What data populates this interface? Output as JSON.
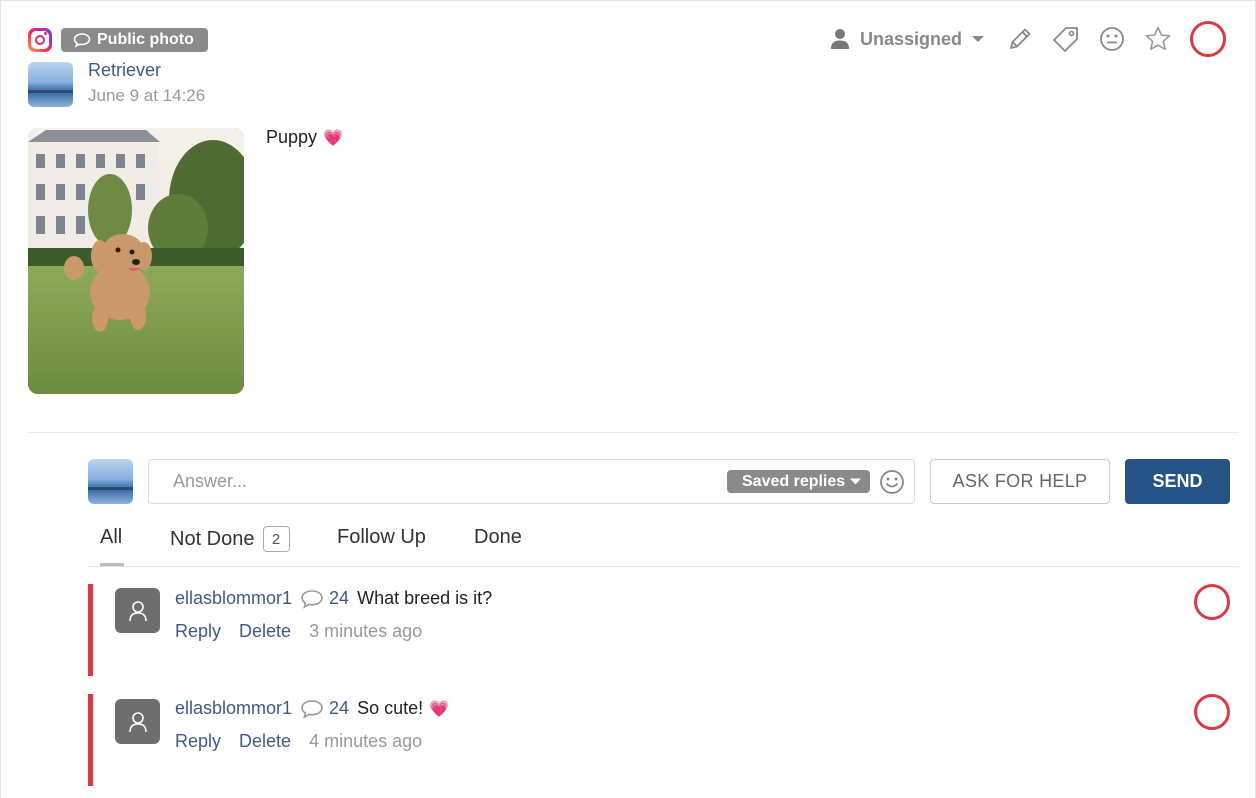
{
  "post": {
    "badge_label": "Public photo",
    "author_name": "Retriever",
    "date": "June 9 at 14:26",
    "caption": "Puppy",
    "caption_emoji": "💗"
  },
  "toolbar": {
    "assignee_label": "Unassigned"
  },
  "composer": {
    "placeholder": "Answer...",
    "saved_replies_label": "Saved replies",
    "ask_help_label": "ASK FOR HELP",
    "send_label": "SEND"
  },
  "tabs": [
    {
      "label": "All",
      "active": true
    },
    {
      "label": "Not Done",
      "count": "2"
    },
    {
      "label": "Follow Up"
    },
    {
      "label": "Done"
    }
  ],
  "comments": [
    {
      "user": "ellasblommor1",
      "count": "24",
      "text": "What breed is it?",
      "emoji": "",
      "reply_label": "Reply",
      "delete_label": "Delete",
      "time": "3 minutes ago"
    },
    {
      "user": "ellasblommor1",
      "count": "24",
      "text": "So cute!",
      "emoji": "💗",
      "reply_label": "Reply",
      "delete_label": "Delete",
      "time": "4 minutes ago"
    }
  ],
  "colors": {
    "accent_blue": "#255386",
    "link_blue": "#3c5a8c",
    "status_red": "#d83b45",
    "badge_gray": "#8a8a8a"
  },
  "icons": [
    "instagram-icon",
    "speech-bubble-icon",
    "user-icon",
    "caret-down-icon",
    "pencil-icon",
    "tag-icon",
    "smiley-icon",
    "star-icon",
    "status-ring-icon",
    "avatar-placeholder-icon",
    "heart-icon"
  ]
}
